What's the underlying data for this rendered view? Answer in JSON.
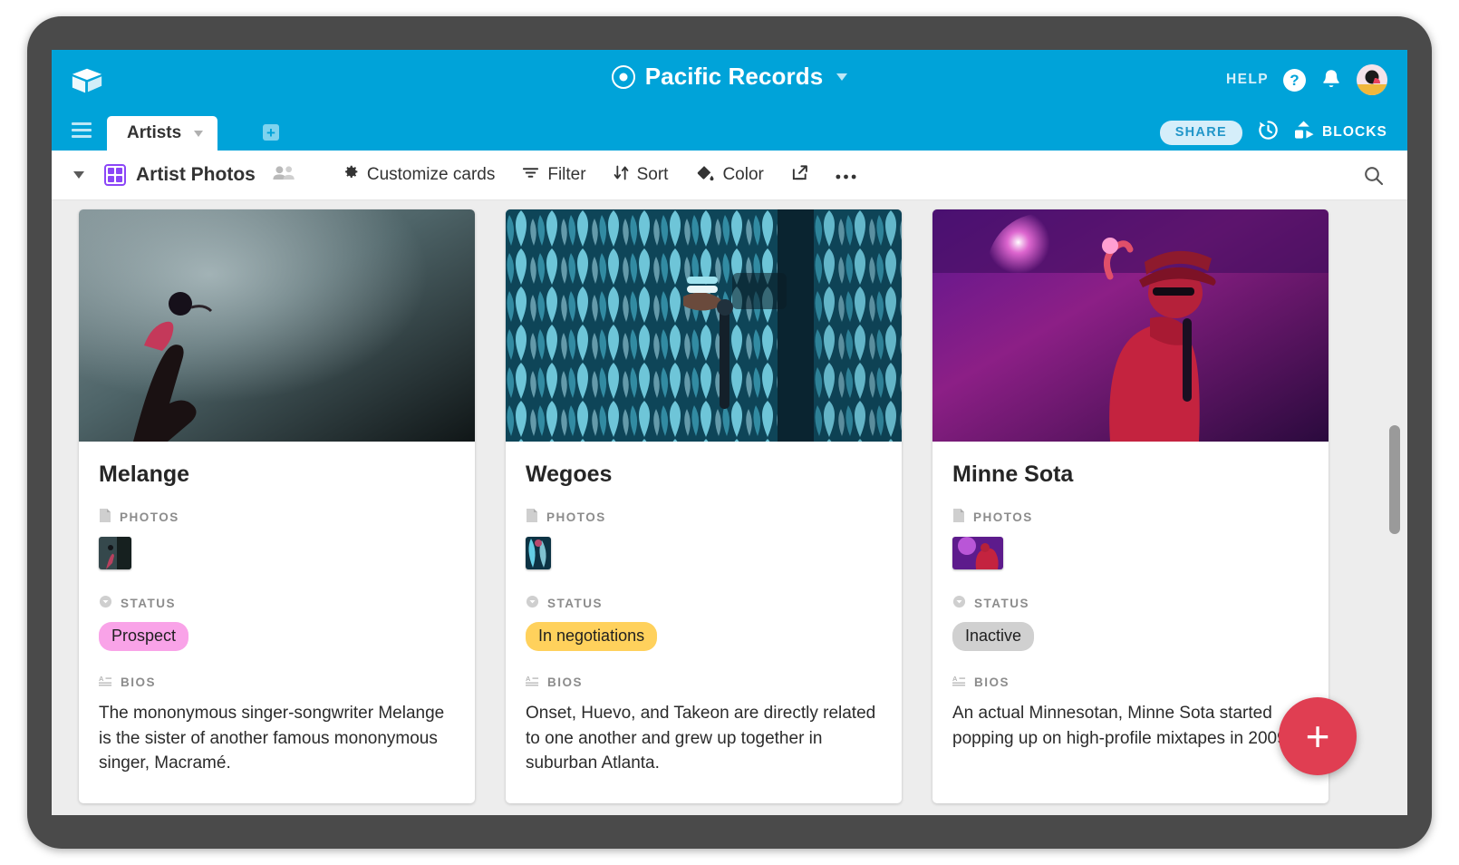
{
  "header": {
    "app_title": "Pacific Records",
    "record_icon": "record-circle-icon",
    "title_caret": "chevron-down-icon",
    "logo": "airtable-cube-logo",
    "help_label": "HELP",
    "help_icon": "question-mark-icon",
    "notifications_icon": "bell-icon",
    "avatar": "user-avatar",
    "brand_color": "#00a3d9"
  },
  "tabs": {
    "menu_icon": "hamburger-menu-icon",
    "items": [
      {
        "label": "Artists",
        "active": true,
        "caret": "chevron-down-icon"
      }
    ],
    "add_tab_label": "+",
    "share_label": "SHARE",
    "history_icon": "history-clock-icon",
    "blocks_label": "BLOCKS",
    "blocks_icon": "blocks-shapes-icon"
  },
  "toolbar": {
    "view_caret": "chevron-down-icon",
    "view_icon": "gallery-grid-icon",
    "view_icon_color": "#8b46f7",
    "view_name": "Artist Photos",
    "collaborators_icon": "collaborators-icon",
    "customize_label": "Customize cards",
    "customize_icon": "gear-icon",
    "filter_label": "Filter",
    "filter_icon": "filter-funnel-icon",
    "sort_label": "Sort",
    "sort_icon": "sort-arrows-icon",
    "color_label": "Color",
    "color_icon": "paint-bucket-icon",
    "share_view_icon": "external-link-icon",
    "more_icon": "ellipsis-icon",
    "search_icon": "search-icon"
  },
  "gallery": {
    "add_record_label": "+",
    "cards": [
      {
        "title": "Melange",
        "photos_label": "PHOTOS",
        "photos_icon": "attachment-file-icon",
        "status_label": "STATUS",
        "status_icon": "single-select-icon",
        "status_value": "Prospect",
        "status_color": "#f9a3e8",
        "bios_label": "BIOS",
        "bios_icon": "long-text-icon",
        "bio": "The mononymous singer-songwriter Melange is the sister of another famous mononymous singer, Macramé."
      },
      {
        "title": "Wegoes",
        "photos_label": "PHOTOS",
        "photos_icon": "attachment-file-icon",
        "status_label": "STATUS",
        "status_icon": "single-select-icon",
        "status_value": "In negotiations",
        "status_color": "#ffd15c",
        "bios_label": "BIOS",
        "bios_icon": "long-text-icon",
        "bio": "Onset, Huevo, and Takeon are directly related to one another and grew up together in suburban Atlanta."
      },
      {
        "title": "Minne Sota",
        "photos_label": "PHOTOS",
        "photos_icon": "attachment-file-icon",
        "status_label": "STATUS",
        "status_icon": "single-select-icon",
        "status_value": "Inactive",
        "status_color": "#d0d0d0",
        "bios_label": "BIOS",
        "bios_icon": "long-text-icon",
        "bio": "An actual Minnesotan, Minne Sota started popping up on high-profile mixtapes in 2009."
      }
    ]
  }
}
